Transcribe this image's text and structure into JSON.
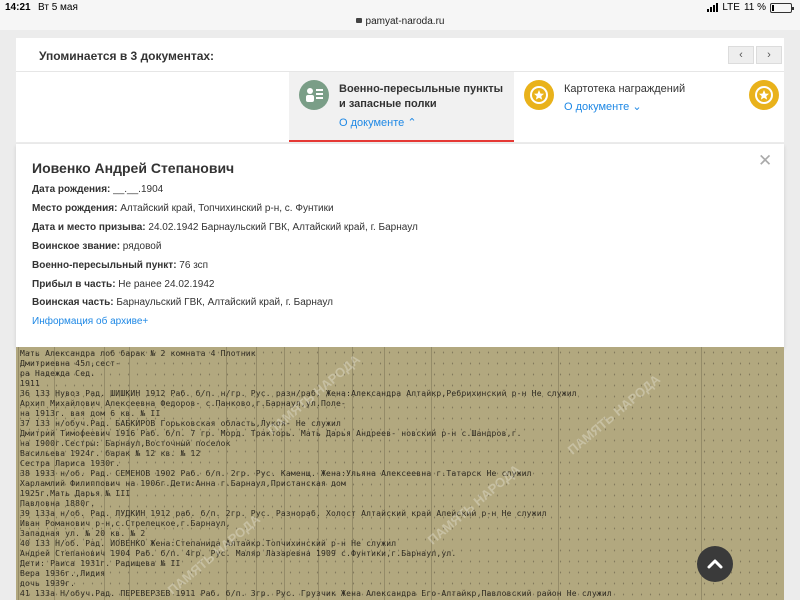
{
  "status_bar": {
    "time": "14:21",
    "date": "Вт 5 мая",
    "network": "LTE",
    "battery": "11 %",
    "battery_level": 0.11
  },
  "browser": {
    "url": "pamyat-naroda.ru"
  },
  "documents": {
    "header": "Упоминается в 3 документах:",
    "prev_label": "‹",
    "next_label": "›",
    "tabs": [
      {
        "title": "Военно-пересыльные пункты и запасные полки",
        "link": "О документе",
        "icon": "people-list-icon",
        "active": true
      },
      {
        "title": "Картотека награждений",
        "link": "О документе",
        "icon": "award-icon",
        "active": false
      },
      {
        "title": "",
        "link": "",
        "icon": "award-icon",
        "active": false
      }
    ]
  },
  "person": {
    "name": "Иовенко Андрей Степанович",
    "fields": [
      {
        "label": "Дата рождения:",
        "value": " __.__.1904"
      },
      {
        "label": "Место рождения:",
        "value": " Алтайский край, Топчихинский р-н, с. Фунтики"
      },
      {
        "label": "Дата и место призыва:",
        "value": " 24.02.1942 Барнаульский ГВК, Алтайский край, г. Барнаул"
      },
      {
        "label": "Воинское звание:",
        "value": " рядовой"
      },
      {
        "label": "Военно-пересыльный пункт:",
        "value": " 76 зсп"
      },
      {
        "label": "Прибыл в часть:",
        "value": " Не ранее 24.02.1942"
      },
      {
        "label": "Воинская часть:",
        "value": " Барнаульский ГВК, Алтайский край, г. Барнаул"
      }
    ],
    "archive_link": "Информация об архиве+"
  },
  "scan": {
    "lines": [
      "                                                         Мать Александра         лоб барак № 2  комната 4    Плотник",
      "                                                         Дмитриевна 45л,сест-",
      "                                                         ра Надежда Сед.",
      "                                                         1911",
      "36 133  Нувоз Рад.    ШИШКИН     1912  Раб.  б/п.  н/гр. Рус.  разн/раб.  Жена:Александра  Алтайкр,Ребрихинский р-н  Не служил",
      "                      Архип Михайлович                              Алексеевна Федоров-  с.Панково,г.Барнаул,ул.Поле-",
      "                                                                   на 1913г.           вая дом 6 кв.  № II",
      "37 133   н/обуч.Рад.  БАБКИРОВ                                                         Горьковская область,Лукоя-  Не служил",
      "                      Дмитрий Тимофеевич 1916  Раб.  б/п.  7 гр. Морд. Тракторь. Мать Дарья Андреев-  новский р-н с.Шандров,г.",
      "                                                                   на 1900г.Сестры:    Барнаул,Восточный поселок",
      "                                                                   Васильева 1924г.    барак № 12 кв. № 12",
      "                                                                   Сестра Лариса 1930г.",
      "38 1933  н/об.  Рад.  СЕМЕНОВ                1902   Раб. б/п. 2гр.  Рус.   Каменщ.  Жена:Ульяна Алексеевна  г.Татарск  Не служил",
      "                      Харламлий Филиппович                                 на 1906г.Дети:Анна  г.Барнаул,Пристанская дом",
      "                                                                   1925г.Мать Дарья     № III",
      "                                                                   Павловна 1880г.",
      "39 133а н/об.   Рад.  ЛУДКИН                 1912   раб.  б/п.  2гр. Рус.  Разнораб. Холост    Алтайский край Алейский р-н  Не служил",
      "                      Иван Романович                                                    р-н,с.Стрелецкое,г.Барнаул,",
      "                                                                                       Западная ул.  № 20  кв.  № 2",
      "40 133   Н/об.  Рад.  ИОВЕНКО                                   Жена:Степанида       Алтайкр.Топчихинский р-н  Не служил",
      "                      Андрей Степанович  1904  Раб.  б/п. 4гр.  Рус.   Маляр    Лазаревна 1909     с.Фунтики,г.Барнаул,ул.",
      "                                                                   Дети: Раиса 1931г.   Радищева № II",
      "                                                                   Вера 1936г.,Лидия",
      "                                                                   дочь 1939г.",
      "41 133а Н/обуч.Рад.  ПЕРЕВЕРЗЕВ              1911   Раб.  б/п.  3гр.  Рус.  Грузчик  Жена Александра  Его-Алтайкр,Павловский район  Не служил"
    ],
    "watermark": "ПАМЯТЬ НАРОДА"
  },
  "scroll_top": {
    "icon": "chevron-up-icon"
  },
  "colors": {
    "accent": "#1e88e5",
    "active_underline": "#e53935",
    "icon_green": "#7a9e87",
    "icon_gold": "#e9b21b",
    "scan_paper": "#b2a87f"
  }
}
